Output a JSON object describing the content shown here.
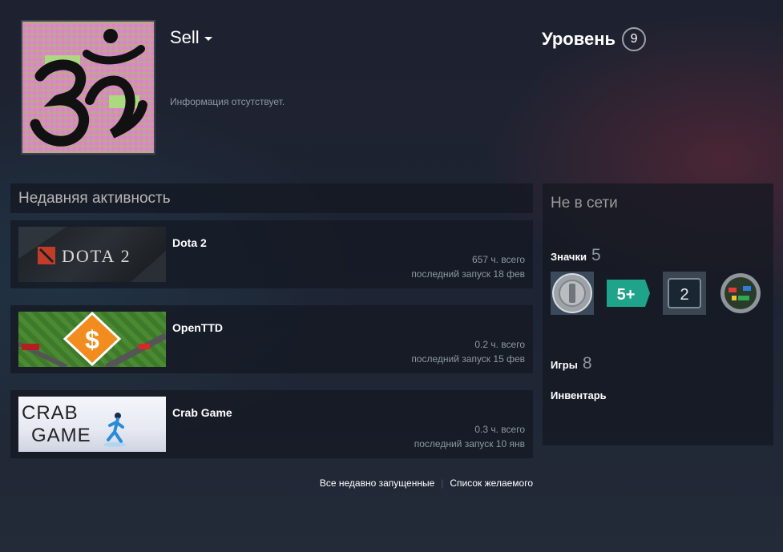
{
  "profile": {
    "persona_name": "Sell",
    "summary": "Информация отсутствует."
  },
  "level": {
    "label": "Уровень",
    "value": "9"
  },
  "activity": {
    "header": "Недавняя активность",
    "games": [
      {
        "name": "Dota 2",
        "hours": "657 ч. всего",
        "last_played": "последний запуск 18 фев",
        "capsule_text": "DOTA 2"
      },
      {
        "name": "OpenTTD",
        "hours": "0.2 ч. всего",
        "last_played": "последний запуск 15 фев",
        "capsule_text": "$"
      },
      {
        "name": "Crab Game",
        "hours": "0.3 ч. всего",
        "last_played": "последний запуск 10 янв",
        "capsule_text_1": "CRAB",
        "capsule_text_2": "GAME"
      }
    ],
    "links": {
      "all_recent": "Все недавно запущенные",
      "wishlist": "Список желаемого"
    }
  },
  "sidebar": {
    "status": "Не в сети",
    "badges_label": "Значки",
    "badges_count": "5",
    "badges": [
      {
        "icon": "silver-coin-badge-icon"
      },
      {
        "icon": "five-plus-badge-icon",
        "text": "5+"
      },
      {
        "icon": "number-badge-icon",
        "text": "2"
      },
      {
        "icon": "colorful-ring-badge-icon"
      }
    ],
    "games_label": "Игры",
    "games_count": "8",
    "inventory_label": "Инвентарь"
  },
  "colors": {
    "accent_white": "#ffffff",
    "muted_text": "#8f98a0",
    "panel_bg": "#141821",
    "dota_red": "#c23c2a"
  }
}
